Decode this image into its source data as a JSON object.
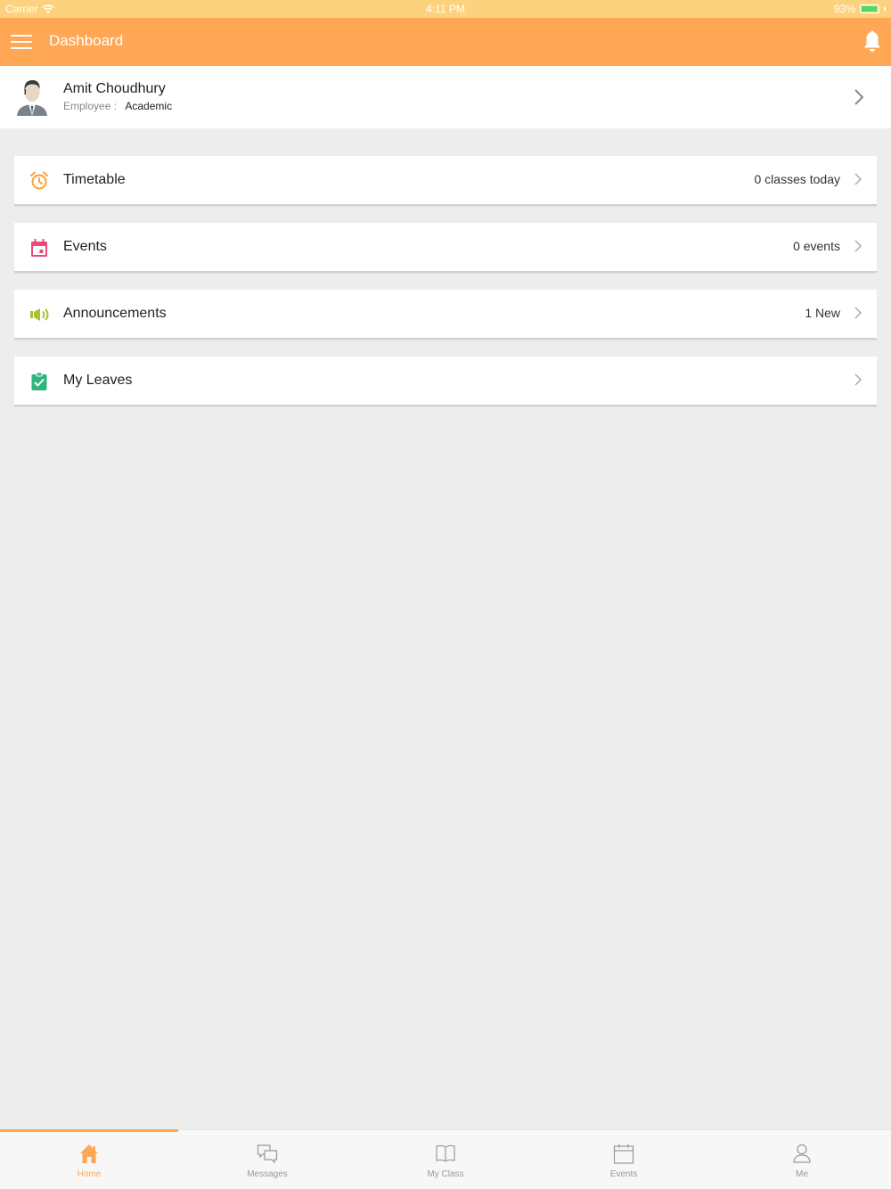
{
  "status_bar": {
    "carrier": "Carrier",
    "time": "4:11 PM",
    "battery": "93%"
  },
  "nav": {
    "title": "Dashboard",
    "menu_icon": "hamburger-menu-icon",
    "bell_icon": "bell-icon"
  },
  "profile": {
    "name": "Amit Choudhury",
    "role_label": "Employee :",
    "department": "Academic",
    "avatar_icon": "avatar"
  },
  "cards": [
    {
      "label": "Timetable",
      "value": "0 classes today",
      "icon": "alarm-clock-icon",
      "color": "#ffa133"
    },
    {
      "label": "Events",
      "value": "0 events",
      "icon": "calendar-icon",
      "color": "#e94a78"
    },
    {
      "label": "Announcements",
      "value": "1 New",
      "icon": "megaphone-icon",
      "color": "#a7c132"
    },
    {
      "label": "My Leaves",
      "value": "",
      "icon": "clipboard-check-icon",
      "color": "#2fb47c"
    }
  ],
  "tabs": [
    {
      "label": "Home",
      "icon": "home-icon",
      "active": true
    },
    {
      "label": "Messages",
      "icon": "messages-icon"
    },
    {
      "label": "My Class",
      "icon": "book-icon"
    },
    {
      "label": "Events",
      "icon": "calendar-icon"
    },
    {
      "label": "Me",
      "icon": "person-icon"
    }
  ],
  "colors": {
    "accent": "#ffa755",
    "status_bar": "#fdd27f",
    "background": "#ededed"
  }
}
